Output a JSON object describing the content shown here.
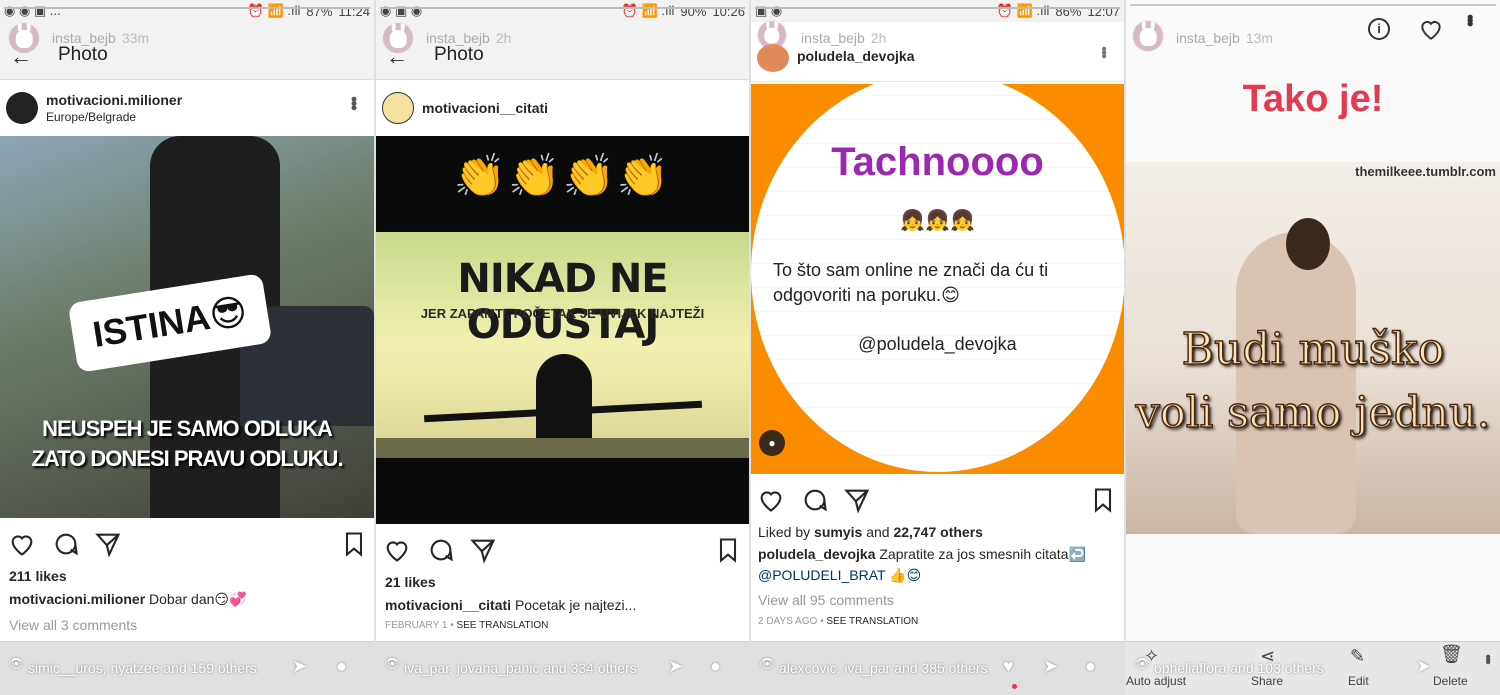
{
  "panels": [
    {
      "status": {
        "left_icons": "◉ ◉ ▣ ...",
        "right_icons": "⏰ 📶 .ıll",
        "battery": "87%",
        "time": "11:24"
      },
      "story": {
        "username": "insta_bejb",
        "time": "33m",
        "title": "Photo"
      },
      "post": {
        "username": "motivacioni.milioner",
        "location": "Europe/Belgrade"
      },
      "image": {
        "sticker": "ISTINA😎",
        "quote_line1": "NEUSPEH JE SAMO ODLUKA",
        "quote_line2": "ZATO DONESI PRAVU ODLUKU."
      },
      "likes": "211 likes",
      "caption_user": "motivacioni.milioner",
      "caption_text": "Dobar dan😏💞",
      "comments": "View all 3 comments",
      "bottom": "simic__uros, nyatzee and 159 others"
    },
    {
      "status": {
        "left_icons": "◉ ▣ ◉",
        "right_icons": "⏰ 📶 .ıll",
        "battery": "90%",
        "time": "10:26"
      },
      "story": {
        "username": "insta_bejb",
        "time": "2h",
        "title": "Photo"
      },
      "post": {
        "username": "motivacioni__citati",
        "location": ""
      },
      "image": {
        "emoji": "👏👏👏👏",
        "headline": "NIKAD NE ODUSTAJ",
        "subline": "JER ZAPAMTI, POČETAK JE UVIJEK NAJTEŽI"
      },
      "likes": "21 likes",
      "caption_user": "motivacioni__citati",
      "caption_text": "Pocetak je najtezi...",
      "date": "FEBRUARY 1",
      "see_translation": "SEE TRANSLATION",
      "bottom": "iva_par, jovana_panic and 334 others"
    },
    {
      "status": {
        "left_icons": "▣ ◉",
        "right_icons": "⏰ 📶 .ıll",
        "battery": "86%",
        "time": "12:07"
      },
      "story": {
        "username": "insta_bejb",
        "time": "2h"
      },
      "post": {
        "username": "poludela_devojka",
        "location": ""
      },
      "image": {
        "title": "Tachnoooo",
        "emoji": "👧👧👧",
        "body": "To što sam online ne znači da ću ti odgovoriti na poruku.😊",
        "handle": "@poludela_devojka"
      },
      "liked_by_prefix": "Liked by",
      "liked_by_user": "sumyis",
      "liked_by_and": "and",
      "liked_by_others": "22,747 others",
      "caption_user": "poludela_devojka",
      "caption_text": "Zapratite za jos smesnih citata↩️",
      "caption_line2": "@POLUDELI_BRAT 👍😊",
      "comments": "View all 95 comments",
      "date": "2 DAYS AGO",
      "see_translation": "SEE TRANSLATION",
      "bottom": "alexcovic, iva_par and 385 others"
    },
    {
      "story": {
        "username": "insta_bejb",
        "time": "13m"
      },
      "image": {
        "title": "Tako je!",
        "watermark": "themilkeee.tumblr.com",
        "quote_line1": "Budi muško",
        "quote_line2": "voli samo jednu."
      },
      "bottom": "opheliaflora and 103 others",
      "tools": [
        "Auto adjust",
        "Share",
        "Edit",
        "Delete"
      ]
    }
  ],
  "colors": {
    "orange": "#fb8c00",
    "purple": "#9c27b0",
    "red": "#e53950",
    "link": "#003569"
  }
}
